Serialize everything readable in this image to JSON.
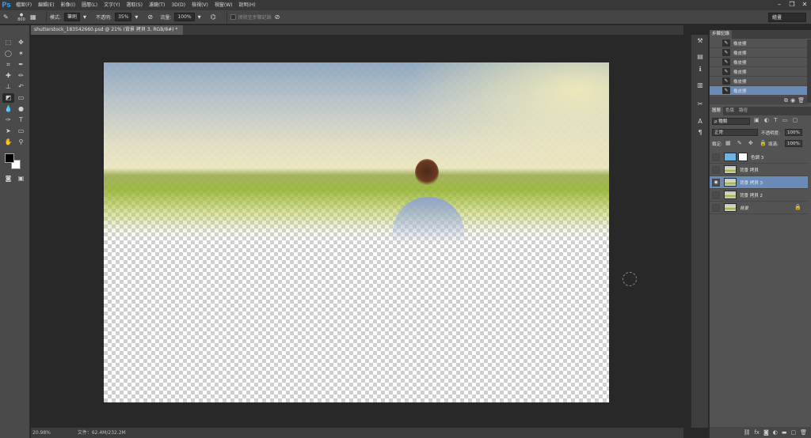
{
  "app": {
    "logo": "Ps"
  },
  "menu": [
    "檔案(F)",
    "編輯(E)",
    "影像(I)",
    "圖層(L)",
    "文字(Y)",
    "選取(S)",
    "濾鏡(T)",
    "3D(D)",
    "檢視(V)",
    "視窗(W)",
    "說明(H)"
  ],
  "window_controls": {
    "minimize": "–",
    "restore": "❐",
    "close": "✕"
  },
  "options_bar": {
    "brush_size": "800",
    "mode_label": "模式:",
    "mode_value": "筆刷",
    "opacity_label": "不透明:",
    "opacity_value": "35%",
    "flow_label": "流量:",
    "flow_value": "100%",
    "history_erase_label": "擦除至步驟記錄",
    "workspace": "繪畫"
  },
  "document": {
    "tab_title": "shutterstock_183542660.psd @ 21% (背景 拷貝 3, RGB/8#) *",
    "tab_close": "×"
  },
  "status": {
    "zoom": "20.98%",
    "doc_info": "文件：62.4M/232.2M"
  },
  "history_panel": {
    "tabs": [
      "步驟記錄"
    ],
    "items": [
      "橡皮擦",
      "橡皮擦",
      "橡皮擦",
      "橡皮擦",
      "橡皮擦",
      "橡皮擦"
    ],
    "selected_index": 5
  },
  "layers_panel": {
    "tabs": [
      "圖層",
      "色版",
      "路徑"
    ],
    "filter_label": "ρ 種類",
    "blend_mode": "正常",
    "opacity_label": "不透明度:",
    "opacity_value": "100%",
    "lock_label": "鎖定:",
    "fill_label": "填滿:",
    "fill_value": "100%",
    "layers": [
      {
        "name": "色調 3",
        "visible": false,
        "selected": false,
        "locked": false
      },
      {
        "name": "背景 拷貝",
        "visible": false,
        "selected": false,
        "locked": false
      },
      {
        "name": "背景 拷貝 3",
        "visible": true,
        "selected": true,
        "locked": false
      },
      {
        "name": "背景 拷貝 2",
        "visible": false,
        "selected": false,
        "locked": false
      },
      {
        "name": "背景",
        "visible": false,
        "selected": false,
        "locked": true
      }
    ]
  },
  "colors": {
    "foreground": "#000000",
    "background": "#ffffff",
    "selection": "#6a8bb8"
  }
}
